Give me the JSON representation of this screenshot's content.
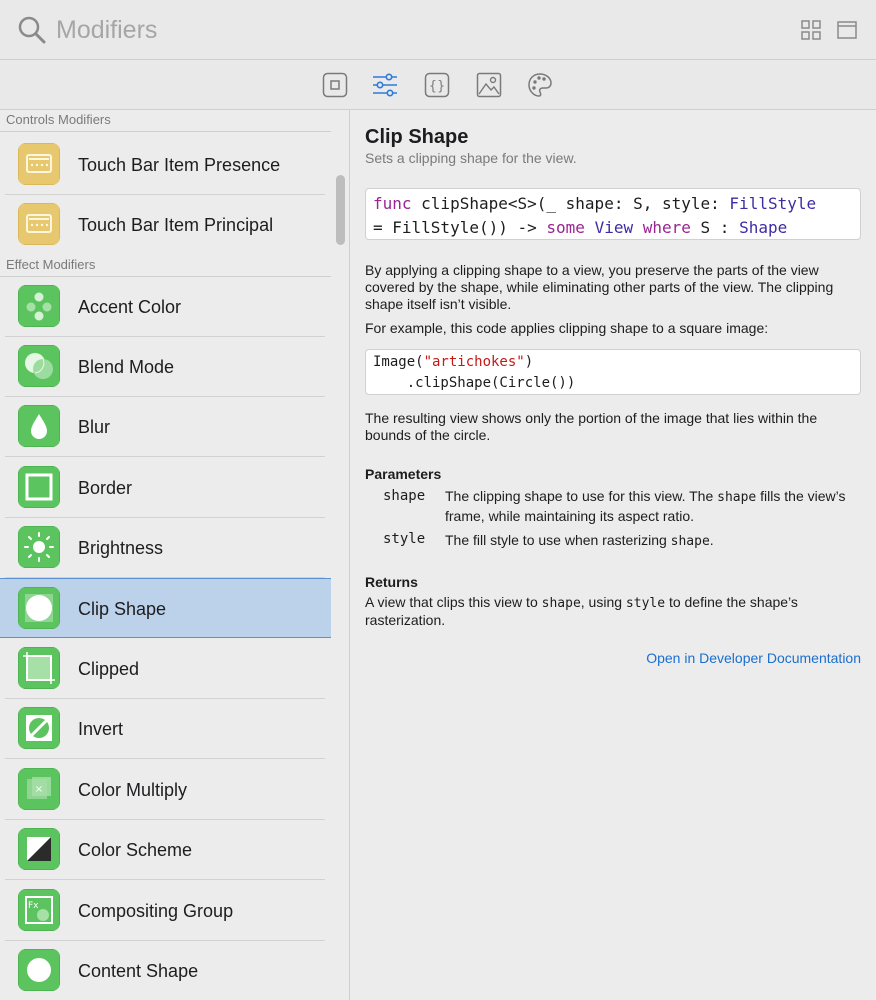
{
  "search": {
    "placeholder": "Modifiers"
  },
  "toolbar": {
    "buttons": [
      {
        "icon": "square-icon",
        "active": false
      },
      {
        "icon": "sliders-icon",
        "active": true
      },
      {
        "icon": "braces-icon",
        "active": false
      },
      {
        "icon": "image-icon",
        "active": false
      },
      {
        "icon": "palette-icon",
        "active": false
      }
    ]
  },
  "sidebar": {
    "sections": [
      {
        "header": "Controls Modifiers",
        "items": [
          {
            "label": "Touch Bar Item Presence",
            "icon": "touchbar-icon"
          },
          {
            "label": "Touch Bar Item Principal",
            "icon": "touchbar-icon"
          }
        ]
      },
      {
        "header": "Effect Modifiers",
        "items": [
          {
            "label": "Accent Color",
            "icon": "accent-color-icon"
          },
          {
            "label": "Blend Mode",
            "icon": "blend-mode-icon"
          },
          {
            "label": "Blur",
            "icon": "blur-icon"
          },
          {
            "label": "Border",
            "icon": "border-icon"
          },
          {
            "label": "Brightness",
            "icon": "brightness-icon"
          },
          {
            "label": "Clip Shape",
            "icon": "clip-shape-icon",
            "selected": true
          },
          {
            "label": "Clipped",
            "icon": "clipped-icon"
          },
          {
            "label": "Invert",
            "icon": "invert-icon"
          },
          {
            "label": "Color Multiply",
            "icon": "color-multiply-icon"
          },
          {
            "label": "Color Scheme",
            "icon": "color-scheme-icon"
          },
          {
            "label": "Compositing Group",
            "icon": "compositing-group-icon"
          },
          {
            "label": "Content Shape",
            "icon": "content-shape-icon"
          }
        ]
      }
    ]
  },
  "detail": {
    "title": "Clip Shape",
    "subtitle": "Sets a clipping shape for the view.",
    "signature": {
      "line1": [
        "func",
        " clipShape<S>(_ shape: S, style: ",
        "FillStyle"
      ],
      "line2": [
        "= FillStyle()) -> ",
        "some",
        " ",
        "View",
        " ",
        "where",
        " S : ",
        "Shape"
      ]
    },
    "description": "By applying a clipping shape to a view, you preserve the parts of the view covered by the shape, while eliminating other parts of the view. The clipping shape itself isn’t visible.",
    "example_intro": "For example, this code applies clipping shape to a square image:",
    "example_code": {
      "line1_prefix": "Image(",
      "line1_string": "\"artichokes\"",
      "line1_suffix": ")",
      "line2": "    .clipShape(Circle())"
    },
    "result_text": "The resulting view shows only the portion of the image that lies within the bounds of the circle.",
    "parameters_title": "Parameters",
    "parameters": [
      {
        "name": "shape",
        "desc_parts": [
          "The clipping shape to use for this view. The ",
          "shape",
          " fills the view’s frame, while maintaining its aspect ratio."
        ]
      },
      {
        "name": "style",
        "desc_parts": [
          "The fill style to use when rasterizing ",
          "shape",
          "."
        ]
      }
    ],
    "returns_title": "Returns",
    "returns_parts": [
      "A view that clips this view to ",
      "shape",
      ", using ",
      "style",
      " to define the shape’s rasterization."
    ],
    "doc_link": "Open in Developer Documentation"
  },
  "colors": {
    "effect_icon": "#5cc45f",
    "control_icon": "#e7c86e",
    "selection": "#bcd2ea",
    "link": "#1a6fd1",
    "toolbar_active": "#2f7bd8"
  }
}
